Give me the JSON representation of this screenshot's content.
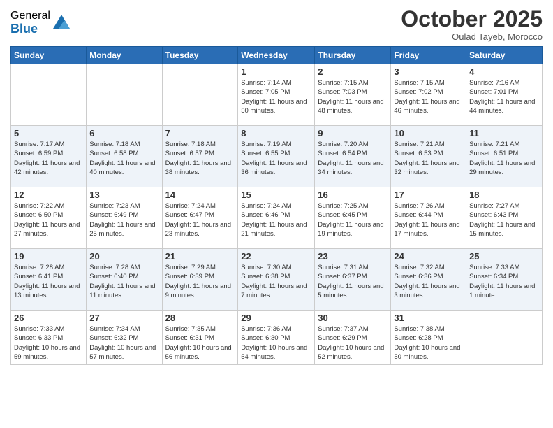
{
  "logo": {
    "general": "General",
    "blue": "Blue"
  },
  "title": "October 2025",
  "subtitle": "Oulad Tayeb, Morocco",
  "days_of_week": [
    "Sunday",
    "Monday",
    "Tuesday",
    "Wednesday",
    "Thursday",
    "Friday",
    "Saturday"
  ],
  "weeks": [
    [
      {
        "day": "",
        "sunrise": "",
        "sunset": "",
        "daylight": "",
        "empty": true
      },
      {
        "day": "",
        "sunrise": "",
        "sunset": "",
        "daylight": "",
        "empty": true
      },
      {
        "day": "",
        "sunrise": "",
        "sunset": "",
        "daylight": "",
        "empty": true
      },
      {
        "day": "1",
        "sunrise": "Sunrise: 7:14 AM",
        "sunset": "Sunset: 7:05 PM",
        "daylight": "Daylight: 11 hours and 50 minutes."
      },
      {
        "day": "2",
        "sunrise": "Sunrise: 7:15 AM",
        "sunset": "Sunset: 7:03 PM",
        "daylight": "Daylight: 11 hours and 48 minutes."
      },
      {
        "day": "3",
        "sunrise": "Sunrise: 7:15 AM",
        "sunset": "Sunset: 7:02 PM",
        "daylight": "Daylight: 11 hours and 46 minutes."
      },
      {
        "day": "4",
        "sunrise": "Sunrise: 7:16 AM",
        "sunset": "Sunset: 7:01 PM",
        "daylight": "Daylight: 11 hours and 44 minutes."
      }
    ],
    [
      {
        "day": "5",
        "sunrise": "Sunrise: 7:17 AM",
        "sunset": "Sunset: 6:59 PM",
        "daylight": "Daylight: 11 hours and 42 minutes."
      },
      {
        "day": "6",
        "sunrise": "Sunrise: 7:18 AM",
        "sunset": "Sunset: 6:58 PM",
        "daylight": "Daylight: 11 hours and 40 minutes."
      },
      {
        "day": "7",
        "sunrise": "Sunrise: 7:18 AM",
        "sunset": "Sunset: 6:57 PM",
        "daylight": "Daylight: 11 hours and 38 minutes."
      },
      {
        "day": "8",
        "sunrise": "Sunrise: 7:19 AM",
        "sunset": "Sunset: 6:55 PM",
        "daylight": "Daylight: 11 hours and 36 minutes."
      },
      {
        "day": "9",
        "sunrise": "Sunrise: 7:20 AM",
        "sunset": "Sunset: 6:54 PM",
        "daylight": "Daylight: 11 hours and 34 minutes."
      },
      {
        "day": "10",
        "sunrise": "Sunrise: 7:21 AM",
        "sunset": "Sunset: 6:53 PM",
        "daylight": "Daylight: 11 hours and 32 minutes."
      },
      {
        "day": "11",
        "sunrise": "Sunrise: 7:21 AM",
        "sunset": "Sunset: 6:51 PM",
        "daylight": "Daylight: 11 hours and 29 minutes."
      }
    ],
    [
      {
        "day": "12",
        "sunrise": "Sunrise: 7:22 AM",
        "sunset": "Sunset: 6:50 PM",
        "daylight": "Daylight: 11 hours and 27 minutes."
      },
      {
        "day": "13",
        "sunrise": "Sunrise: 7:23 AM",
        "sunset": "Sunset: 6:49 PM",
        "daylight": "Daylight: 11 hours and 25 minutes."
      },
      {
        "day": "14",
        "sunrise": "Sunrise: 7:24 AM",
        "sunset": "Sunset: 6:47 PM",
        "daylight": "Daylight: 11 hours and 23 minutes."
      },
      {
        "day": "15",
        "sunrise": "Sunrise: 7:24 AM",
        "sunset": "Sunset: 6:46 PM",
        "daylight": "Daylight: 11 hours and 21 minutes."
      },
      {
        "day": "16",
        "sunrise": "Sunrise: 7:25 AM",
        "sunset": "Sunset: 6:45 PM",
        "daylight": "Daylight: 11 hours and 19 minutes."
      },
      {
        "day": "17",
        "sunrise": "Sunrise: 7:26 AM",
        "sunset": "Sunset: 6:44 PM",
        "daylight": "Daylight: 11 hours and 17 minutes."
      },
      {
        "day": "18",
        "sunrise": "Sunrise: 7:27 AM",
        "sunset": "Sunset: 6:43 PM",
        "daylight": "Daylight: 11 hours and 15 minutes."
      }
    ],
    [
      {
        "day": "19",
        "sunrise": "Sunrise: 7:28 AM",
        "sunset": "Sunset: 6:41 PM",
        "daylight": "Daylight: 11 hours and 13 minutes."
      },
      {
        "day": "20",
        "sunrise": "Sunrise: 7:28 AM",
        "sunset": "Sunset: 6:40 PM",
        "daylight": "Daylight: 11 hours and 11 minutes."
      },
      {
        "day": "21",
        "sunrise": "Sunrise: 7:29 AM",
        "sunset": "Sunset: 6:39 PM",
        "daylight": "Daylight: 11 hours and 9 minutes."
      },
      {
        "day": "22",
        "sunrise": "Sunrise: 7:30 AM",
        "sunset": "Sunset: 6:38 PM",
        "daylight": "Daylight: 11 hours and 7 minutes."
      },
      {
        "day": "23",
        "sunrise": "Sunrise: 7:31 AM",
        "sunset": "Sunset: 6:37 PM",
        "daylight": "Daylight: 11 hours and 5 minutes."
      },
      {
        "day": "24",
        "sunrise": "Sunrise: 7:32 AM",
        "sunset": "Sunset: 6:36 PM",
        "daylight": "Daylight: 11 hours and 3 minutes."
      },
      {
        "day": "25",
        "sunrise": "Sunrise: 7:33 AM",
        "sunset": "Sunset: 6:34 PM",
        "daylight": "Daylight: 11 hours and 1 minute."
      }
    ],
    [
      {
        "day": "26",
        "sunrise": "Sunrise: 7:33 AM",
        "sunset": "Sunset: 6:33 PM",
        "daylight": "Daylight: 10 hours and 59 minutes."
      },
      {
        "day": "27",
        "sunrise": "Sunrise: 7:34 AM",
        "sunset": "Sunset: 6:32 PM",
        "daylight": "Daylight: 10 hours and 57 minutes."
      },
      {
        "day": "28",
        "sunrise": "Sunrise: 7:35 AM",
        "sunset": "Sunset: 6:31 PM",
        "daylight": "Daylight: 10 hours and 56 minutes."
      },
      {
        "day": "29",
        "sunrise": "Sunrise: 7:36 AM",
        "sunset": "Sunset: 6:30 PM",
        "daylight": "Daylight: 10 hours and 54 minutes."
      },
      {
        "day": "30",
        "sunrise": "Sunrise: 7:37 AM",
        "sunset": "Sunset: 6:29 PM",
        "daylight": "Daylight: 10 hours and 52 minutes."
      },
      {
        "day": "31",
        "sunrise": "Sunrise: 7:38 AM",
        "sunset": "Sunset: 6:28 PM",
        "daylight": "Daylight: 10 hours and 50 minutes."
      },
      {
        "day": "",
        "sunrise": "",
        "sunset": "",
        "daylight": "",
        "empty": true
      }
    ]
  ]
}
